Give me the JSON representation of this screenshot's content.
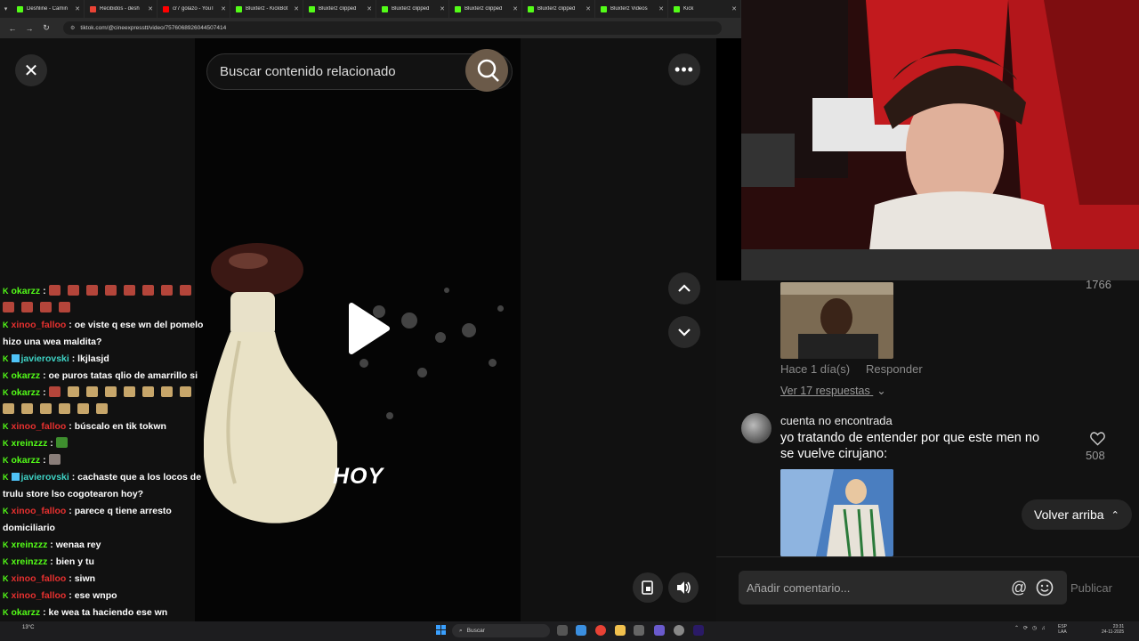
{
  "browser": {
    "tabs": [
      {
        "label": "Deshline - Camin",
        "color": "#53fc18"
      },
      {
        "label": "Recibidos - desh",
        "color": "#ea4335"
      },
      {
        "label": "cr7 golazo - YouT",
        "color": "#ff0000"
      },
      {
        "label": "Bluxterz - KickBot",
        "color": "#53fc18"
      },
      {
        "label": "Bluxterz clipped",
        "color": "#53fc18"
      },
      {
        "label": "Bluxterz clipped",
        "color": "#53fc18"
      },
      {
        "label": "Bluxterz clipped",
        "color": "#53fc18"
      },
      {
        "label": "Bluxterz clipped",
        "color": "#53fc18"
      },
      {
        "label": "Bluxterz Videos",
        "color": "#53fc18"
      },
      {
        "label": "Kick",
        "color": "#53fc18"
      }
    ],
    "url": "tiktok.com/@cineexpresstt/video/7576068926044507414"
  },
  "video": {
    "search_placeholder": "Buscar contenido relacionado",
    "caption": "HOY"
  },
  "chat": [
    {
      "user": "okarzz",
      "user_color": "green",
      "text": "",
      "emotes": [
        "red",
        "red",
        "red",
        "red",
        "red",
        "red",
        "red",
        "red",
        "red",
        "red",
        "red",
        "red"
      ]
    },
    {
      "user": "xinoo_falloo",
      "user_color": "red",
      "text": "oe viste q ese wn del pomelo hizo una wea maldita?"
    },
    {
      "user": "javierovski",
      "user_color": "teal",
      "badge": true,
      "text": "lkjlasjd"
    },
    {
      "user": "okarzz",
      "user_color": "green",
      "text": "oe puros tatas qlio de amarrillo si"
    },
    {
      "user": "okarzz",
      "user_color": "green",
      "text": "",
      "emotes": [
        "red",
        "face",
        "face",
        "face",
        "face",
        "face",
        "face",
        "face",
        "face",
        "face",
        "face",
        "face",
        "face",
        "face"
      ]
    },
    {
      "user": "xinoo_falloo",
      "user_color": "red",
      "text": "búscalo en tik tokwn"
    },
    {
      "user": "xreinzzz",
      "user_color": "green",
      "text": "",
      "emotes": [
        "leaf"
      ]
    },
    {
      "user": "okarzz",
      "user_color": "green",
      "text": "",
      "emotes": [
        "grey"
      ]
    },
    {
      "user": "javierovski",
      "user_color": "teal",
      "badge": true,
      "text": "cachaste que a los locos de trulu store lso cogotearon hoy?"
    },
    {
      "user": "xinoo_falloo",
      "user_color": "red",
      "text": "parece q tiene arresto domiciliario"
    },
    {
      "user": "xreinzzz",
      "user_color": "green",
      "text": "wenaa rey"
    },
    {
      "user": "xreinzzz",
      "user_color": "green",
      "text": "bien y tu"
    },
    {
      "user": "xinoo_falloo",
      "user_color": "red",
      "text": "siwn"
    },
    {
      "user": "xinoo_falloo",
      "user_color": "red",
      "text": "ese wnpo"
    },
    {
      "user": "okarzz",
      "user_color": "green",
      "text": "ke wea ta haciendo ese wn"
    }
  ],
  "comments": {
    "first_like_count": "1766",
    "first_meta_time": "Hace 1 día(s)",
    "first_meta_reply": "Responder",
    "view_replies": "Ver 17 respuestas",
    "second_user": "cuenta no encontrada",
    "second_text": "yo tratando de entender por que este men no se vuelve cirujano:",
    "second_like_count": "508",
    "back_to_top": "Volver arriba",
    "input_placeholder": "Añadir comentario...",
    "publish": "Publicar"
  },
  "taskbar": {
    "weather": "13°C",
    "search": "Buscar",
    "lang_top": "ESP",
    "lang_bottom": "LAA",
    "time": "23:31",
    "date": "24-11-2025"
  },
  "colors": {
    "kick_green": "#53fc18",
    "chat_red": "#e5302f",
    "chat_teal": "#3ed3c5"
  }
}
